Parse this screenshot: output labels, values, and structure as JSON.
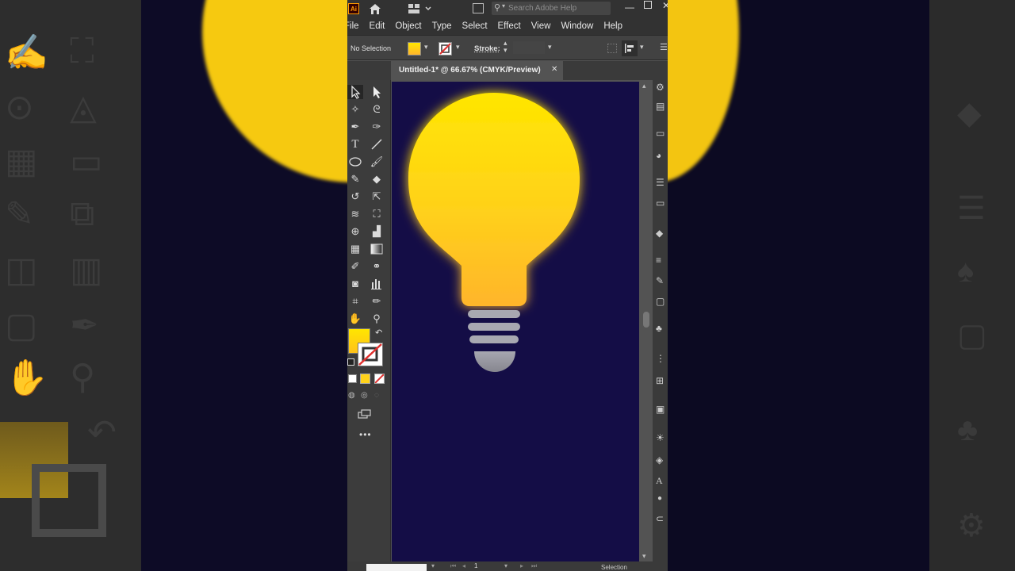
{
  "app": {
    "logo": "Ai",
    "search_placeholder": "Search Adobe Help"
  },
  "menu": [
    "File",
    "Edit",
    "Object",
    "Type",
    "Select",
    "Effect",
    "View",
    "Window",
    "Help"
  ],
  "control": {
    "selection_label": "No Selection",
    "stroke_label": "Stroke:"
  },
  "document": {
    "tab_title": "Untitled-1* @ 66.67% (CMYK/Preview)",
    "page_number": "1",
    "status_text": "Selection"
  },
  "colors": {
    "artboard_bg": "#140d46",
    "bulb_top": "#ffe600",
    "bulb_bottom": "#ffb52b",
    "base_gray": "#a9a9b2",
    "fill_swatch": "#ffd600",
    "ui_dark": "#323232",
    "ui_mid": "#535353"
  },
  "icons": {
    "home": "home-icon",
    "workspace": "workspace-switcher-icon",
    "search": "search-icon",
    "close_tab": "close-icon",
    "more_tools": "ellipsis-icon"
  }
}
